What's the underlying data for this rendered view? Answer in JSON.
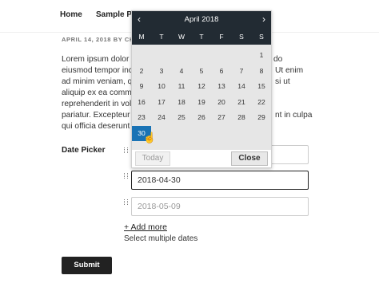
{
  "nav": {
    "home": "Home",
    "sample_page": "Sample Pa"
  },
  "meta": "APRIL 14, 2018 BY CHI",
  "paragraph": [
    {
      "left": "Lorem ipsum dolor",
      "right": "do"
    },
    {
      "left": "eiusmod tempor inc",
      "right": "Ut enim"
    },
    {
      "left": "ad minim veniam, qu",
      "right": "si ut"
    },
    {
      "left": "aliquip ex ea comme",
      "right": ""
    },
    {
      "left": "reprehenderit in volu",
      "right": ""
    },
    {
      "left": "pariatur. Excepteur",
      "right": "nt in culpa"
    },
    {
      "left": "qui officia deserunt",
      "right": ""
    }
  ],
  "form": {
    "label": "Date Picker",
    "date1": "",
    "date2": "2018-04-30",
    "date3_placeholder": "2018-05-09",
    "add_more": "+ Add more",
    "hint": "Select multiple dates",
    "submit": "Submit"
  },
  "calendar": {
    "title": "April 2018",
    "prev": "‹",
    "next": "›",
    "weekdays": [
      "M",
      "T",
      "W",
      "T",
      "F",
      "S",
      "S"
    ],
    "weeks": [
      [
        "",
        "",
        "",
        "",
        "",
        "",
        "1"
      ],
      [
        "2",
        "3",
        "4",
        "5",
        "6",
        "7",
        "8"
      ],
      [
        "9",
        "10",
        "11",
        "12",
        "13",
        "14",
        "15"
      ],
      [
        "16",
        "17",
        "18",
        "19",
        "20",
        "21",
        "22"
      ],
      [
        "23",
        "24",
        "25",
        "26",
        "27",
        "28",
        "29"
      ],
      [
        "30",
        "",
        "",
        "",
        "",
        "",
        ""
      ]
    ],
    "selected_day": "30",
    "today_label": "Today",
    "close_label": "Close"
  }
}
